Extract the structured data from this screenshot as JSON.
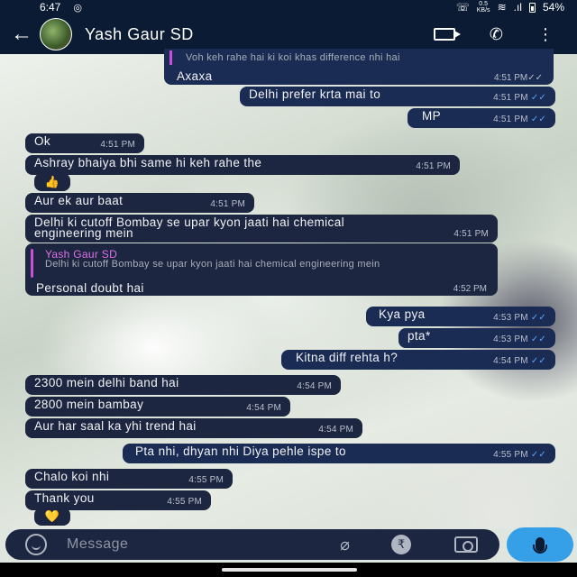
{
  "status_bar": {
    "time": "6:47",
    "net_speed": "0.5\nKB/s",
    "battery": "54%"
  },
  "header": {
    "contact_name": "Yash Gaur SD"
  },
  "messages": {
    "m0_quote": "Voh keh rahe hai ki koi khas difference nhi hai",
    "m0_text": "Axaxa",
    "m0_time": "4:51 PM",
    "m1_text": "Delhi prefer krta mai to",
    "m1_time": "4:51 PM",
    "m2_text": "MP",
    "m2_time": "4:51 PM",
    "m3_text": "Ok",
    "m3_time": "4:51 PM",
    "m4_text": "Ashray bhaiya bhi same hi keh rahe the",
    "m4_time": "4:51 PM",
    "m4_reaction": "👍",
    "m5_text": "Aur ek aur baat",
    "m5_time": "4:51 PM",
    "m6_text": "Delhi ki cutoff Bombay se upar kyon jaati hai chemical engineering mein",
    "m6_time": "4:51 PM",
    "m7_quote_name": "Yash Gaur SD",
    "m7_quote_text": "Delhi ki cutoff Bombay se upar kyon jaati hai chemical engineering mein",
    "m7_text": "Personal doubt hai",
    "m7_time": "4:52 PM",
    "m8_text": "Kya pya",
    "m8_time": "4:53 PM",
    "m9_text": "pta*",
    "m9_time": "4:53 PM",
    "m10_text": "Kitna diff rehta h?",
    "m10_time": "4:54 PM",
    "m11_text": "2300 mein delhi band hai",
    "m11_time": "4:54 PM",
    "m12_text": "2800 mein bambay",
    "m12_time": "4:54 PM",
    "m13_text": "Aur har saal ka yhi trend hai",
    "m13_time": "4:54 PM",
    "m14_text": "Pta nhi, dhyan nhi Diya pehle ispe to",
    "m14_time": "4:55 PM",
    "m15_text": "Chalo koi nhi",
    "m15_time": "4:55 PM",
    "m16_text": "Thank you",
    "m16_time": "4:55 PM",
    "m16_reaction": "💛"
  },
  "composer": {
    "placeholder": "Message",
    "rupee": "₹"
  },
  "colors": {
    "header": "#0b1b33",
    "bubble_in": "#1c2640",
    "bubble_out": "#1a2c54",
    "read_ticks": "#5aa0ff",
    "mic_button": "#35a0e8",
    "quote_bar": "#c84fd8"
  }
}
